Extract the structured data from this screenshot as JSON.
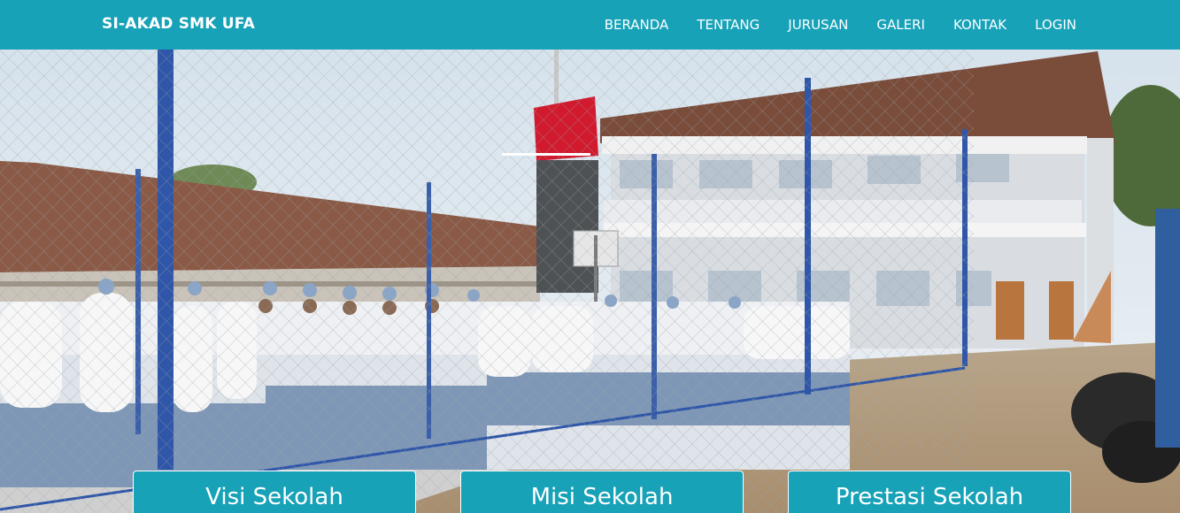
{
  "navbar": {
    "brand": "SI-AKAD SMK UFA",
    "links": [
      {
        "label": "BERANDA"
      },
      {
        "label": "TENTANG"
      },
      {
        "label": "JURUSAN"
      },
      {
        "label": "GALERI"
      },
      {
        "label": "KONTAK"
      },
      {
        "label": "LOGIN"
      }
    ]
  },
  "hero": {
    "image": "school-assembly-photo",
    "carousel": {
      "active_slide": 1
    }
  },
  "cards": [
    {
      "label": "Visi Sekolah"
    },
    {
      "label": "Misi Sekolah"
    },
    {
      "label": "Prestasi Sekolah"
    }
  ],
  "colors": {
    "primary": "#17a2b8",
    "text_on_primary": "#ffffff"
  }
}
